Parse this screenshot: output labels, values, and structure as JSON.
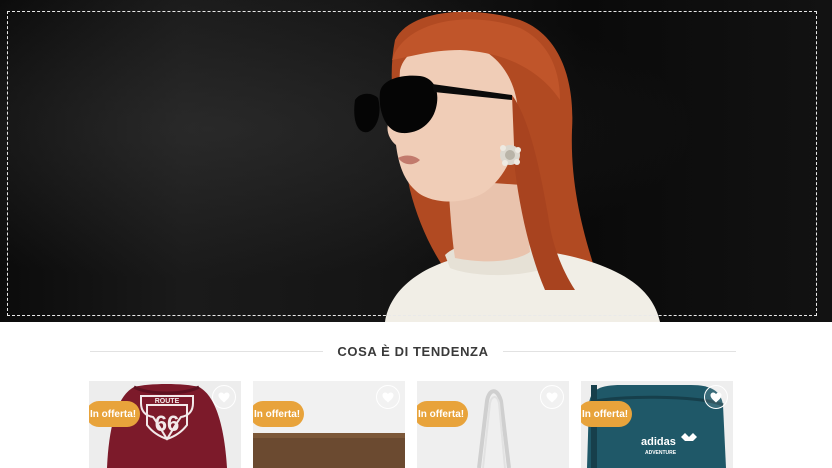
{
  "hero": {
    "image_icon": "woman-sunglasses-banner"
  },
  "trending": {
    "title": "COSA È DI TENDENZA"
  },
  "products": [
    {
      "badge": "In offerta!",
      "image_icon": "route-66-drawstring-bag",
      "logo_top": "ROUTE",
      "logo_number": "66"
    },
    {
      "badge": "In offerta!",
      "image_icon": "brown-wallet"
    },
    {
      "badge": "In offerta!",
      "image_icon": "white-tote-bag"
    },
    {
      "badge": "In offerta!",
      "image_icon": "adidas-adventure-bag",
      "logo_text": "adidas",
      "logo_subtext": "ADVENTURE"
    }
  ],
  "icons": {
    "wishlist": "heart-icon"
  },
  "colors": {
    "badge": "#e8a33b",
    "hero_bg": "#0f0f0f",
    "title_text": "#3a3a3a"
  }
}
